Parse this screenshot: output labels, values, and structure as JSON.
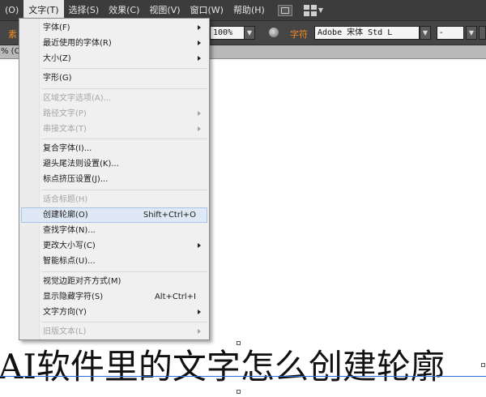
{
  "menubar": {
    "items": [
      {
        "label": "(O)"
      },
      {
        "label": "文字(T)"
      },
      {
        "label": "选择(S)"
      },
      {
        "label": "效果(C)"
      },
      {
        "label": "视图(V)"
      },
      {
        "label": "窗口(W)"
      },
      {
        "label": "帮助(H)"
      }
    ],
    "active_index": 1
  },
  "controlbar": {
    "left_label": "素",
    "zoom_value": "100%",
    "char_label": "字符",
    "font_family_value": "Adobe 宋体 Std L",
    "font_style_value": "-"
  },
  "doctab": {
    "label": "% (CI"
  },
  "text_menu": {
    "items": [
      {
        "label": "字体(F)",
        "shortcut": "",
        "submenu": true,
        "disabled": false
      },
      {
        "label": "最近使用的字体(R)",
        "shortcut": "",
        "submenu": true,
        "disabled": false
      },
      {
        "label": "大小(Z)",
        "shortcut": "",
        "submenu": true,
        "disabled": false
      },
      {
        "label": "字形(G)",
        "shortcut": "",
        "submenu": false,
        "disabled": false
      },
      {
        "label": "区域文字选项(A)...",
        "shortcut": "",
        "submenu": false,
        "disabled": true
      },
      {
        "label": "路径文字(P)",
        "shortcut": "",
        "submenu": true,
        "disabled": true
      },
      {
        "label": "串接文本(T)",
        "shortcut": "",
        "submenu": true,
        "disabled": true
      },
      {
        "label": "复合字体(I)...",
        "shortcut": "",
        "submenu": false,
        "disabled": false
      },
      {
        "label": "避头尾法则设置(K)...",
        "shortcut": "",
        "submenu": false,
        "disabled": false
      },
      {
        "label": "标点挤压设置(J)...",
        "shortcut": "",
        "submenu": false,
        "disabled": false
      },
      {
        "label": "适合标题(H)",
        "shortcut": "",
        "submenu": false,
        "disabled": true
      },
      {
        "label": "创建轮廓(O)",
        "shortcut": "Shift+Ctrl+O",
        "submenu": false,
        "disabled": false,
        "highlighted": true
      },
      {
        "label": "查找字体(N)...",
        "shortcut": "",
        "submenu": false,
        "disabled": false
      },
      {
        "label": "更改大小写(C)",
        "shortcut": "",
        "submenu": true,
        "disabled": false
      },
      {
        "label": "智能标点(U)...",
        "shortcut": "",
        "submenu": false,
        "disabled": false
      },
      {
        "label": "视觉边距对齐方式(M)",
        "shortcut": "",
        "submenu": false,
        "disabled": false
      },
      {
        "label": "显示隐藏字符(S)",
        "shortcut": "Alt+Ctrl+I",
        "submenu": false,
        "disabled": false
      },
      {
        "label": "文字方向(Y)",
        "shortcut": "",
        "submenu": true,
        "disabled": false
      },
      {
        "label": "旧版文本(L)",
        "shortcut": "",
        "submenu": true,
        "disabled": true
      }
    ]
  },
  "canvas": {
    "headline": "AI软件里的文字怎么创建轮廓"
  },
  "colors": {
    "accent": "#f08a24",
    "menu_highlight": "#dfe9f6",
    "baseline": "#2a6edc"
  }
}
